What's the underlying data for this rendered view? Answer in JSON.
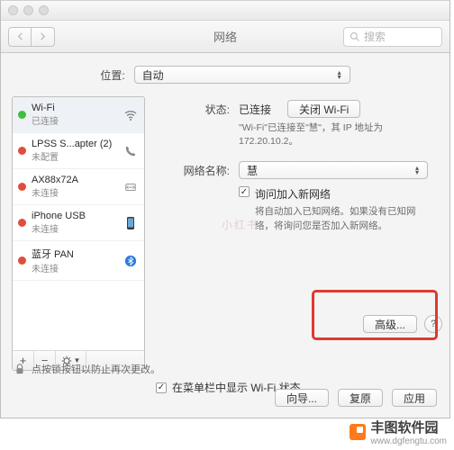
{
  "window": {
    "title": "网络"
  },
  "search": {
    "placeholder": "搜索"
  },
  "location": {
    "label": "位置:",
    "value": "自动"
  },
  "sidebar": {
    "items": [
      {
        "name": "Wi-Fi",
        "sub": "已连接",
        "status": "green",
        "icon": "wifi"
      },
      {
        "name": "LPSS S...apter (2)",
        "sub": "未配置",
        "status": "red",
        "icon": "phone"
      },
      {
        "name": "AX88x72A",
        "sub": "未连接",
        "status": "red",
        "icon": "ethernet"
      },
      {
        "name": "iPhone USB",
        "sub": "未连接",
        "status": "red",
        "icon": "iphone"
      },
      {
        "name": "蓝牙 PAN",
        "sub": "未连接",
        "status": "red",
        "icon": "bluetooth"
      }
    ],
    "footer": {
      "add": "+",
      "remove": "−",
      "gear": "✻▾"
    }
  },
  "main": {
    "status_label": "状态:",
    "status_value": "已连接",
    "wifi_off_btn": "关闭 Wi-Fi",
    "status_desc_1": "\"Wi-Fi\"已连接至\"慧\"，其 IP 地址为",
    "status_desc_2": "172.20.10.2。",
    "network_label": "网络名称:",
    "network_value": "慧",
    "ask_join_label": "询问加入新网络",
    "ask_join_desc": "将自动加入已知网络。如果没有已知网络，将询问您是否加入新网络。",
    "menubar_label": "在菜单栏中显示 Wi-Fi 状态",
    "advanced_btn": "高级...",
    "help_btn": "?"
  },
  "lock": {
    "text": "点按锁按钮以防止再次更改。"
  },
  "buttons": {
    "assist": "向导...",
    "revert": "复原",
    "apply": "应用"
  },
  "brand": {
    "name": "丰图软件园",
    "url": "www.dgfengtu.com"
  },
  "watermark": "小红书"
}
